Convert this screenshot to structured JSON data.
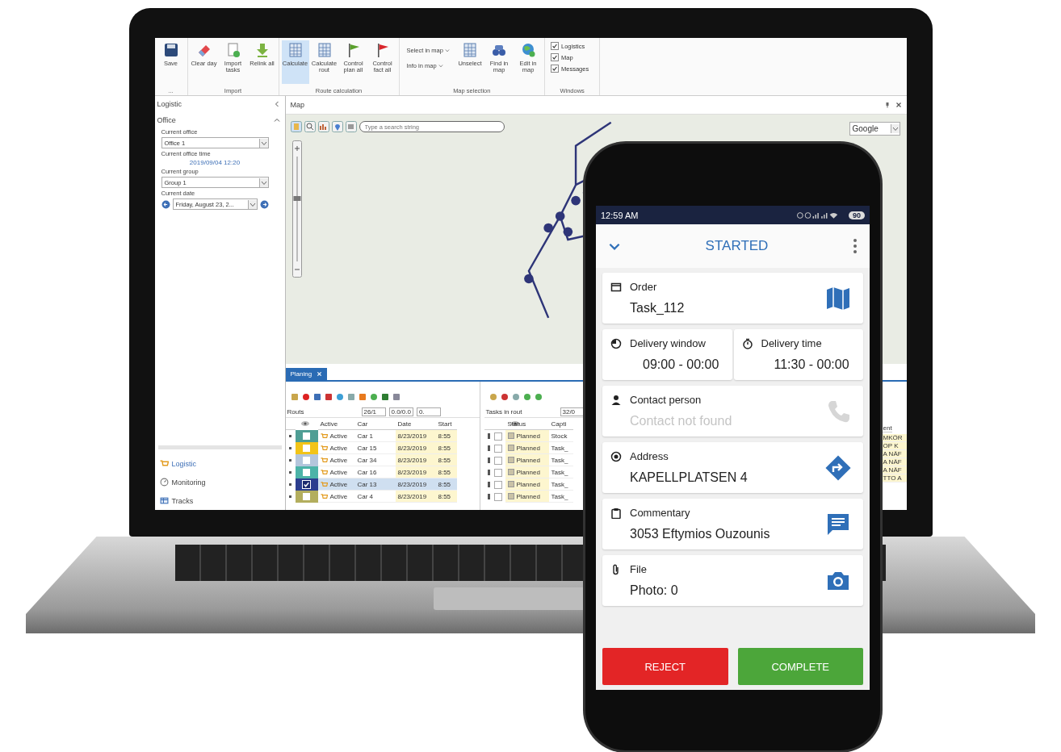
{
  "ribbon": {
    "groups": [
      {
        "label": "...",
        "buttons": [
          {
            "label": "Save",
            "selected": false
          }
        ]
      },
      {
        "label": "Import",
        "buttons": [
          {
            "label": "Clear day",
            "selected": false
          },
          {
            "label": "Import tasks",
            "selected": false
          },
          {
            "label": "Relink all",
            "selected": false
          }
        ]
      },
      {
        "label": "Route calculation",
        "buttons": [
          {
            "label": "Calculate",
            "selected": true
          },
          {
            "label": "Calculate rout",
            "selected": false
          },
          {
            "label": "Control plan all",
            "selected": false
          },
          {
            "label": "Control fact all",
            "selected": false
          }
        ]
      },
      {
        "label": "Map selection",
        "menus": [
          "Select in map",
          "Info in map"
        ],
        "buttons": [
          {
            "label": "Unselect",
            "selected": false
          },
          {
            "label": "Find in map",
            "selected": false
          },
          {
            "label": "Edit in map",
            "selected": false
          }
        ]
      },
      {
        "label": "Windows",
        "checks": [
          {
            "label": "Logistics",
            "checked": true
          },
          {
            "label": "Map",
            "checked": true
          },
          {
            "label": "Messages",
            "checked": true
          }
        ]
      }
    ]
  },
  "sidebar": {
    "title": "Logistic",
    "section": "Office",
    "current_office_label": "Current office",
    "current_office": "Office 1",
    "office_time_label": "Current office time",
    "office_time": "2019/09/04 12:20",
    "group_label": "Current group",
    "group": "Group 1",
    "date_label": "Current date",
    "date": "Friday, August 23, 2...",
    "nav": [
      {
        "label": "Logistic",
        "selected": true
      },
      {
        "label": "Monitoring",
        "selected": false
      },
      {
        "label": "Tracks",
        "selected": false
      }
    ]
  },
  "map": {
    "title": "Map",
    "search": {
      "placeholder": "Type a search string"
    },
    "provider": "Google",
    "zoom": {
      "level": 0.6
    }
  },
  "planning": {
    "tab": "Planing",
    "routes": {
      "title": "Routs",
      "counts": [
        "26/1",
        "0.0/0.0",
        "0."
      ],
      "columns": [
        "Active",
        "Car",
        "Date",
        "Start"
      ],
      "rows": [
        {
          "color": "#4f9e94",
          "checked": false,
          "selected": false,
          "status": "Active",
          "car": "Car 1",
          "date": "8/23/2019",
          "start": "8:55"
        },
        {
          "color": "#f2c418",
          "checked": false,
          "selected": false,
          "status": "Active",
          "car": "Car 15",
          "date": "8/23/2019",
          "start": "8:55"
        },
        {
          "color": "#b4c6dc",
          "checked": false,
          "selected": false,
          "status": "Active",
          "car": "Car 34",
          "date": "8/23/2019",
          "start": "8:55"
        },
        {
          "color": "#4cb3a8",
          "checked": false,
          "selected": false,
          "status": "Active",
          "car": "Car 16",
          "date": "8/23/2019",
          "start": "8:55"
        },
        {
          "color": "#2c3e8f",
          "checked": true,
          "selected": true,
          "status": "Active",
          "car": "Car 13",
          "date": "8/23/2019",
          "start": "8:55"
        },
        {
          "color": "#b3ae5e",
          "checked": false,
          "selected": false,
          "status": "Active",
          "car": "Car 4",
          "date": "8/23/2019",
          "start": "8:55"
        }
      ]
    },
    "tasks": {
      "title": "Tasks in rout",
      "count": "32/0",
      "columns": [
        "Status",
        "Capti",
        "ent"
      ],
      "rows": [
        {
          "checked": false,
          "status": "Planned",
          "caption": "Stock",
          "column_3": "MKÖR"
        },
        {
          "checked": false,
          "status": "Planned",
          "caption": "Task_",
          "column_3": "OP K"
        },
        {
          "checked": false,
          "status": "Planned",
          "caption": "Task_",
          "column_3": "A NÄF"
        },
        {
          "checked": false,
          "status": "Planned",
          "caption": "Task_",
          "column_3": "A NÄF"
        },
        {
          "checked": false,
          "status": "Planned",
          "caption": "Task_",
          "column_3": "A NÄF"
        },
        {
          "checked": false,
          "status": "Planned",
          "caption": "Task_",
          "column_3": "TTO A"
        }
      ]
    }
  },
  "phone": {
    "time": "12:59 AM",
    "battery": "90",
    "title": "STARTED",
    "cards": [
      {
        "label": "Order",
        "value": "Task_112",
        "disabled": false
      },
      {
        "label": "Delivery window",
        "value": "09:00 - 00:00",
        "disabled": false
      },
      {
        "label": "Delivery time",
        "value": "11:30 - 00:00",
        "disabled": false
      },
      {
        "label": "Contact person",
        "value": "Contact not found",
        "disabled": true
      },
      {
        "label": "Address",
        "value": "KAPELLPLATSEN 4",
        "disabled": false
      },
      {
        "label": "Commentary",
        "value": "3053 Eftymios Ouzounis",
        "disabled": false
      },
      {
        "label": "File",
        "value": "Photo: 0",
        "disabled": false
      }
    ],
    "buttons": [
      {
        "label": "REJECT",
        "kind": "reject"
      },
      {
        "label": "COMPLETE",
        "kind": "complete"
      }
    ]
  }
}
